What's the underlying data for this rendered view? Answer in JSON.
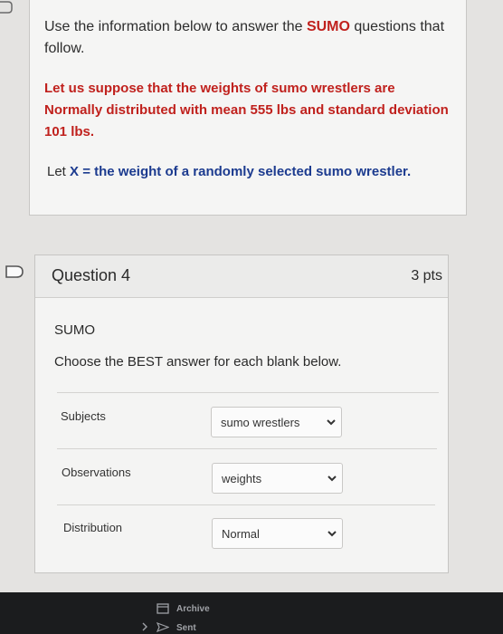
{
  "info": {
    "intro_prefix": "Use the information below to answer the ",
    "intro_highlight": "SUMO",
    "intro_suffix": " questions that follow.",
    "body": "Let us suppose that the weights of sumo wrestlers are Normally distributed with mean 555 lbs and standard deviation 101 lbs.",
    "let_prefix": "Let ",
    "let_definition": "X = the weight of a randomly selected sumo wrestler."
  },
  "question": {
    "title": "Question 4",
    "points": "3 pts",
    "topic": "SUMO",
    "instruction": "Choose the BEST answer for each blank below.",
    "rows": [
      {
        "label": "Subjects",
        "selected": "sumo wrestlers"
      },
      {
        "label": "Observations",
        "selected": "weights"
      },
      {
        "label": "Distribution",
        "selected": "Normal"
      }
    ]
  },
  "bottom_nav": {
    "items": [
      {
        "label": "Archive",
        "icon": "archive-icon"
      },
      {
        "label": "Sent",
        "icon": "sent-icon"
      }
    ]
  },
  "colors": {
    "highlight_red": "#c0211d",
    "definition_blue": "#1c3b8f",
    "bottom_bar": "#1b1c1e"
  }
}
